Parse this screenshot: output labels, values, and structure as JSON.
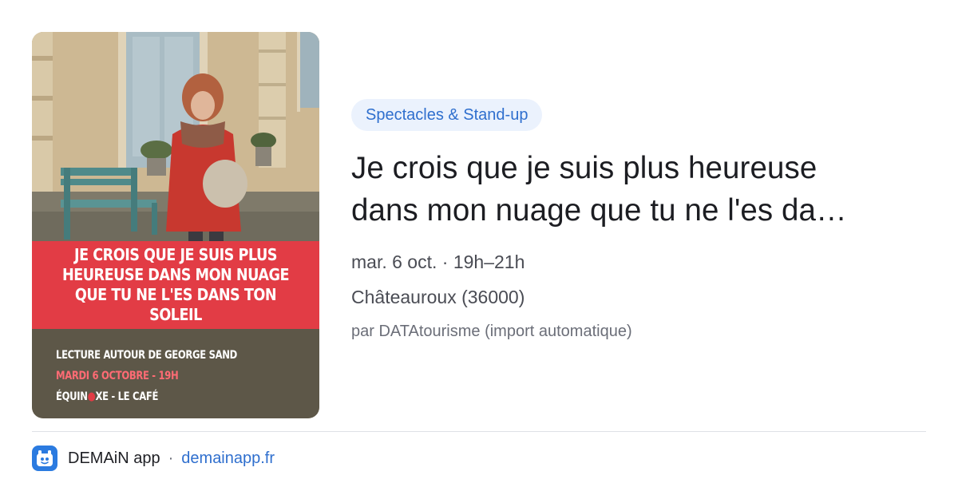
{
  "poster": {
    "headline": "JE CROIS QUE JE SUIS PLUS HEUREUSE DANS MON NUAGE QUE TU NE L'ES DANS TON SOLEIL",
    "line1": "LECTURE AUTOUR DE GEORGE SAND",
    "line2": "MARDI 6 OCTOBRE - 19H",
    "line3_a": "ÉQUIN",
    "line3_b": "XE - LE CAFÉ",
    "accent": "#e23c45"
  },
  "category": "Spectacles & Stand-up",
  "title": {
    "line1": "Je crois que je suis plus heureuse",
    "line2": "dans mon nuage que tu ne l'es da…"
  },
  "date": "mar. 6 oct. · 19h–21h",
  "location": "Châteauroux (36000)",
  "source": "par DATAtourisme (import automatique)",
  "footer": {
    "app_name": "DEMAiN app",
    "separator": "·",
    "domain": "demainapp.fr",
    "icon": "app-logo-icon"
  },
  "colors": {
    "link": "#2f6fce",
    "pill_bg": "#ebf2fd",
    "app_icon_bg": "#2b7be0"
  }
}
